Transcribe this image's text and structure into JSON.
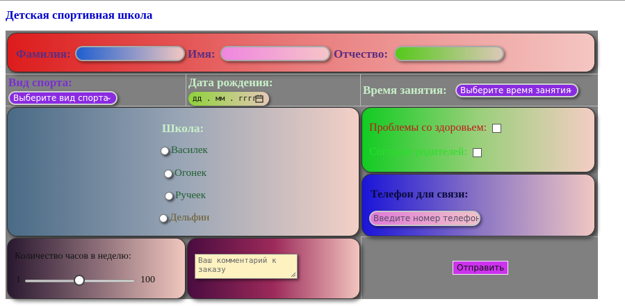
{
  "page": {
    "title": "Детская спортивная школа"
  },
  "name_row": {
    "last_name_label": "Фамилия:",
    "first_name_label": "Имя:",
    "patronymic_label": "Отчество:",
    "last_name_gradient": [
      "#1f5fcf",
      "#f0c7c2"
    ],
    "first_name_gradient": [
      "#f085e0",
      "#f5c5c8"
    ],
    "patronymic_gradient": [
      "#55c81a",
      "#dcc8b8"
    ]
  },
  "sport": {
    "label": "Вид спорта:",
    "selected": "Выберите вид спорта"
  },
  "birth_date": {
    "label": "Дата рождения:",
    "placeholder": "дд . мм . гггг"
  },
  "training_time": {
    "label": "Время занятия:",
    "selected": "Выберите время занятия"
  },
  "school": {
    "title": "Школа:",
    "options": [
      "Василек",
      "Огонек",
      "Ручеек",
      "Дельфин"
    ]
  },
  "health": {
    "problems_label": "Проблемы со здоровьем:",
    "parents_consent_label": "Согласие родителей:"
  },
  "phone": {
    "label": "Телефон для связи:",
    "placeholder": "Введите номер телефона"
  },
  "hours": {
    "label": "Количество часов в неделю:",
    "min": "1",
    "max": "100",
    "value": 50
  },
  "comment": {
    "placeholder": "Ваш комментарий к заказу"
  },
  "submit": {
    "label": "Отправить"
  },
  "colors": {
    "grid_background": "#808080",
    "title": "#0000cc",
    "accent_purple": "#8a2be2",
    "submit": "#cc33ee"
  }
}
